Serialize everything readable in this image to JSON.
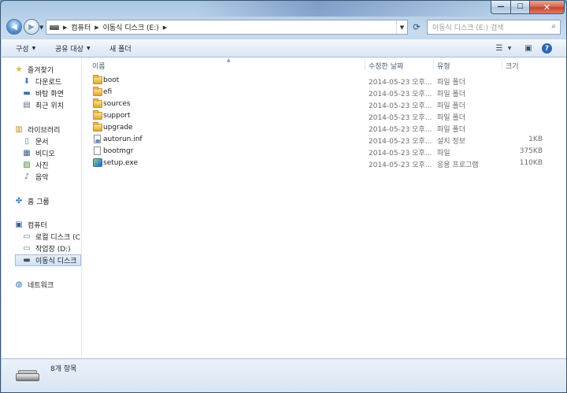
{
  "window": {
    "min_symbol": "—",
    "max_symbol": "☐",
    "close_symbol": "✕"
  },
  "address": {
    "crumbs": [
      "컴퓨터",
      "이동식 디스크 (E:)"
    ]
  },
  "search": {
    "placeholder": "이동식 디스크 (E:) 검색"
  },
  "toolbar": {
    "organize": "구성",
    "share": "공유 대상",
    "new_folder": "새 폴더"
  },
  "sidebar": {
    "items": [
      {
        "label": "즐겨찾기",
        "icon": "star-icon"
      },
      {
        "label": "다운로드",
        "icon": "downloads-icon"
      },
      {
        "label": "바탕 화면",
        "icon": "desktop-icon"
      },
      {
        "label": "최근 위치",
        "icon": "recent-places-icon"
      },
      {
        "label": "라이브러리",
        "icon": "libraries-icon"
      },
      {
        "label": "문서",
        "icon": "documents-icon"
      },
      {
        "label": "비디오",
        "icon": "videos-icon"
      },
      {
        "label": "사진",
        "icon": "pictures-icon"
      },
      {
        "label": "음악",
        "icon": "music-icon"
      },
      {
        "label": "홈 그룹",
        "icon": "homegroup-icon"
      },
      {
        "label": "컴퓨터",
        "icon": "computer-icon"
      },
      {
        "label": "로컬 디스크 (C",
        "icon": "local-disk-icon"
      },
      {
        "label": "작업장 (D:)",
        "icon": "drive-icon"
      },
      {
        "label": "이동식 디스크",
        "icon": "removable-disk-icon"
      },
      {
        "label": "네트워크",
        "icon": "network-icon"
      }
    ]
  },
  "columns": {
    "name": "이름",
    "date": "수정한 날짜",
    "type": "유형",
    "size": "크기"
  },
  "files": [
    {
      "name": "boot",
      "date": "2014-05-23 오후...",
      "type": "파일 폴더",
      "size": "",
      "icon": "folder-icon"
    },
    {
      "name": "efi",
      "date": "2014-05-23 오후...",
      "type": "파일 폴더",
      "size": "",
      "icon": "folder-icon"
    },
    {
      "name": "sources",
      "date": "2014-05-23 오후...",
      "type": "파일 폴더",
      "size": "",
      "icon": "folder-icon"
    },
    {
      "name": "support",
      "date": "2014-05-23 오후...",
      "type": "파일 폴더",
      "size": "",
      "icon": "folder-icon"
    },
    {
      "name": "upgrade",
      "date": "2014-05-23 오후...",
      "type": "파일 폴더",
      "size": "",
      "icon": "folder-icon"
    },
    {
      "name": "autorun.inf",
      "date": "2014-05-23 오후...",
      "type": "설치 정보",
      "size": "1KB",
      "icon": "setup-info-icon"
    },
    {
      "name": "bootmgr",
      "date": "2014-05-23 오후...",
      "type": "파일",
      "size": "375KB",
      "icon": "file-icon"
    },
    {
      "name": "setup.exe",
      "date": "2014-05-23 오후...",
      "type": "응용 프로그램",
      "size": "110KB",
      "icon": "application-icon"
    }
  ],
  "status": {
    "count": "8개 항목"
  }
}
